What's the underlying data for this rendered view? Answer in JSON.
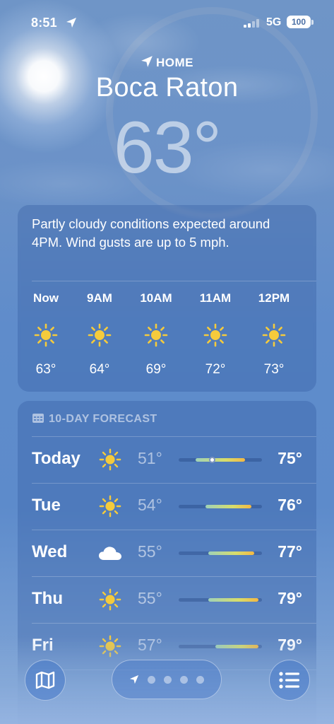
{
  "status_bar": {
    "time": "8:51",
    "network": "5G",
    "battery": "100",
    "signal_bars_active": 2
  },
  "header": {
    "home_label": "HOME",
    "city": "Boca Raton",
    "temperature": "63°"
  },
  "hourly": {
    "summary": "Partly cloudy conditions expected around 4PM. Wind gusts are up to 5 mph.",
    "items": [
      {
        "label": "Now",
        "icon": "sun-icon",
        "temp": "63°"
      },
      {
        "label": "9AM",
        "icon": "sun-icon",
        "temp": "64°"
      },
      {
        "label": "10AM",
        "icon": "sun-icon",
        "temp": "69°"
      },
      {
        "label": "11AM",
        "icon": "sun-icon",
        "temp": "72°"
      },
      {
        "label": "12PM",
        "icon": "sun-icon",
        "temp": "73°"
      }
    ]
  },
  "forecast": {
    "title": "10-DAY FORECAST",
    "days": [
      {
        "day": "Today",
        "icon": "sun-icon",
        "low": "51°",
        "high": "75°",
        "range_start": 0.2,
        "range_end": 0.8,
        "current": 0.4
      },
      {
        "day": "Tue",
        "icon": "sun-icon",
        "low": "54°",
        "high": "76°",
        "range_start": 0.32,
        "range_end": 0.87
      },
      {
        "day": "Wed",
        "icon": "cloud-icon",
        "low": "55°",
        "high": "77°",
        "range_start": 0.36,
        "range_end": 0.91
      },
      {
        "day": "Thu",
        "icon": "sun-icon",
        "low": "55°",
        "high": "79°",
        "range_start": 0.36,
        "range_end": 0.96
      },
      {
        "day": "Fri",
        "icon": "sun-icon",
        "low": "57°",
        "high": "79°",
        "range_start": 0.44,
        "range_end": 0.96
      }
    ]
  },
  "toolbar": {
    "map_icon": "map-icon",
    "location_icon": "location-arrow-icon",
    "list_icon": "list-icon",
    "page_dots": 4
  },
  "colors": {
    "sun": "#F5CB3C",
    "bar_start": "#9fd2b8",
    "bar_end": "#f4b843"
  }
}
